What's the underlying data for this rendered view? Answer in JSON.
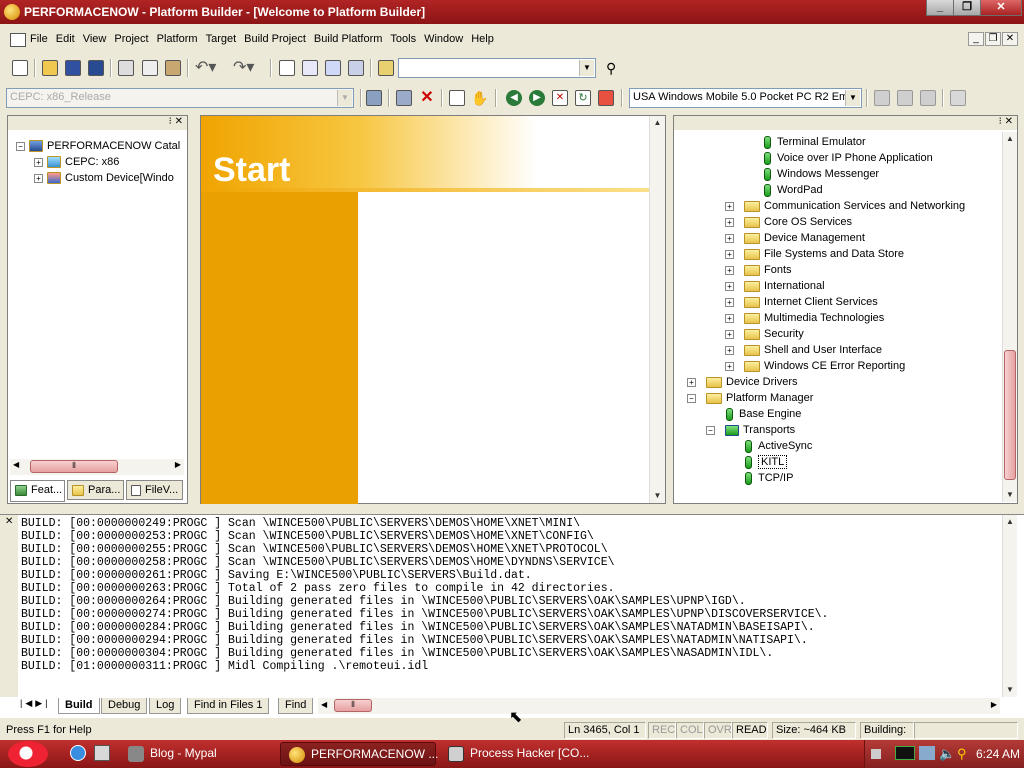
{
  "window": {
    "title": "PERFORMACENOW - Platform Builder - [Welcome to Platform Builder]",
    "minimize": "_",
    "restore": "❐",
    "close": "✕"
  },
  "menu": [
    "File",
    "Edit",
    "View",
    "Project",
    "Platform",
    "Target",
    "Build Project",
    "Build Platform",
    "Tools",
    "Window",
    "Help"
  ],
  "toolbar1": {
    "find_combo": ""
  },
  "toolbar2": {
    "config_combo": "CEPC: x86_Release",
    "sdk_combo": "USA Windows Mobile 5.0 Pocket PC R2 Em"
  },
  "workspace": {
    "tree": [
      {
        "label": "PERFORMACENOW Catal",
        "indent": 0,
        "expander": "−"
      },
      {
        "label": "CEPC: x86",
        "indent": 1,
        "expander": "+"
      },
      {
        "label": "Custom Device[Windo",
        "indent": 1,
        "expander": "+"
      }
    ],
    "tabs": [
      "Feat...",
      "Para...",
      "FileV..."
    ]
  },
  "welcome": {
    "heading": "Start"
  },
  "catalog": {
    "items": [
      {
        "label": "Terminal Emulator",
        "type": "comp",
        "indent": 3
      },
      {
        "label": "Voice over IP Phone Application",
        "type": "comp",
        "indent": 3
      },
      {
        "label": "Windows Messenger",
        "type": "comp",
        "indent": 3
      },
      {
        "label": "WordPad",
        "type": "comp",
        "indent": 3
      },
      {
        "label": "Communication Services and Networking",
        "type": "folder",
        "indent": 2,
        "expander": "+"
      },
      {
        "label": "Core OS Services",
        "type": "folder",
        "indent": 2,
        "expander": "+"
      },
      {
        "label": "Device Management",
        "type": "folder",
        "indent": 2,
        "expander": "+"
      },
      {
        "label": "File Systems and Data Store",
        "type": "folder",
        "indent": 2,
        "expander": "+"
      },
      {
        "label": "Fonts",
        "type": "folder",
        "indent": 2,
        "expander": "+"
      },
      {
        "label": "International",
        "type": "folder",
        "indent": 2,
        "expander": "+"
      },
      {
        "label": "Internet Client Services",
        "type": "folder",
        "indent": 2,
        "expander": "+"
      },
      {
        "label": "Multimedia Technologies",
        "type": "folder",
        "indent": 2,
        "expander": "+"
      },
      {
        "label": "Security",
        "type": "folder",
        "indent": 2,
        "expander": "+"
      },
      {
        "label": "Shell and User Interface",
        "type": "folder",
        "indent": 2,
        "expander": "+"
      },
      {
        "label": "Windows CE Error Reporting",
        "type": "folder",
        "indent": 2,
        "expander": "+"
      },
      {
        "label": "Device Drivers",
        "type": "folder",
        "indent": 0,
        "expander": "+"
      },
      {
        "label": "Platform Manager",
        "type": "folder",
        "indent": 0,
        "expander": "−"
      },
      {
        "label": "Base Engine",
        "type": "comp",
        "indent": 1
      },
      {
        "label": "Transports",
        "type": "group",
        "indent": 1,
        "expander": "−"
      },
      {
        "label": "ActiveSync",
        "type": "comp",
        "indent": 2
      },
      {
        "label": "KITL",
        "type": "comp",
        "indent": 2,
        "selected": true
      },
      {
        "label": "TCP/IP",
        "type": "comp",
        "indent": 2
      }
    ]
  },
  "output": {
    "lines": [
      "BUILD: [00:0000000249:PROGC ] Scan \\WINCE500\\PUBLIC\\SERVERS\\DEMOS\\HOME\\XNET\\MINI\\",
      "BUILD: [00:0000000253:PROGC ] Scan \\WINCE500\\PUBLIC\\SERVERS\\DEMOS\\HOME\\XNET\\CONFIG\\",
      "BUILD: [00:0000000255:PROGC ] Scan \\WINCE500\\PUBLIC\\SERVERS\\DEMOS\\HOME\\XNET\\PROTOCOL\\",
      "BUILD: [00:0000000258:PROGC ] Scan \\WINCE500\\PUBLIC\\SERVERS\\DEMOS\\HOME\\DYNDNS\\SERVICE\\",
      "BUILD: [00:0000000261:PROGC ] Saving E:\\WINCE500\\PUBLIC\\SERVERS\\Build.dat.",
      "BUILD: [00:0000000263:PROGC ] Total of 2 pass zero files to compile in 42 directories.",
      "BUILD: [00:0000000264:PROGC ] Building generated files in \\WINCE500\\PUBLIC\\SERVERS\\OAK\\SAMPLES\\UPNP\\IGD\\.",
      "BUILD: [00:0000000274:PROGC ] Building generated files in \\WINCE500\\PUBLIC\\SERVERS\\OAK\\SAMPLES\\UPNP\\DISCOVERSERVICE\\.",
      "BUILD: [00:0000000284:PROGC ] Building generated files in \\WINCE500\\PUBLIC\\SERVERS\\OAK\\SAMPLES\\NATADMIN\\BASEISAPI\\.",
      "BUILD: [00:0000000294:PROGC ] Building generated files in \\WINCE500\\PUBLIC\\SERVERS\\OAK\\SAMPLES\\NATADMIN\\NATISAPI\\.",
      "BUILD: [00:0000000304:PROGC ] Building generated files in \\WINCE500\\PUBLIC\\SERVERS\\OAK\\SAMPLES\\NASADMIN\\IDL\\.",
      "BUILD: [01:0000000311:PROGC ] Midl Compiling .\\remoteui.idl"
    ],
    "tabs": [
      "Build",
      "Debug",
      "Log",
      "Find in Files 1",
      "Find"
    ]
  },
  "status": {
    "help": "Press F1 for Help",
    "position": "Ln 3465, Col 1",
    "rec": "REC",
    "col": "COL",
    "ovr": "OVR",
    "read": "READ",
    "size": "Size: ~464 KB",
    "building": "Building:"
  },
  "taskbar": {
    "tasks": [
      "Blog - Mypal",
      "PERFORMACENOW ...",
      "Process Hacker [CO..."
    ],
    "clock": "6:24 AM"
  }
}
